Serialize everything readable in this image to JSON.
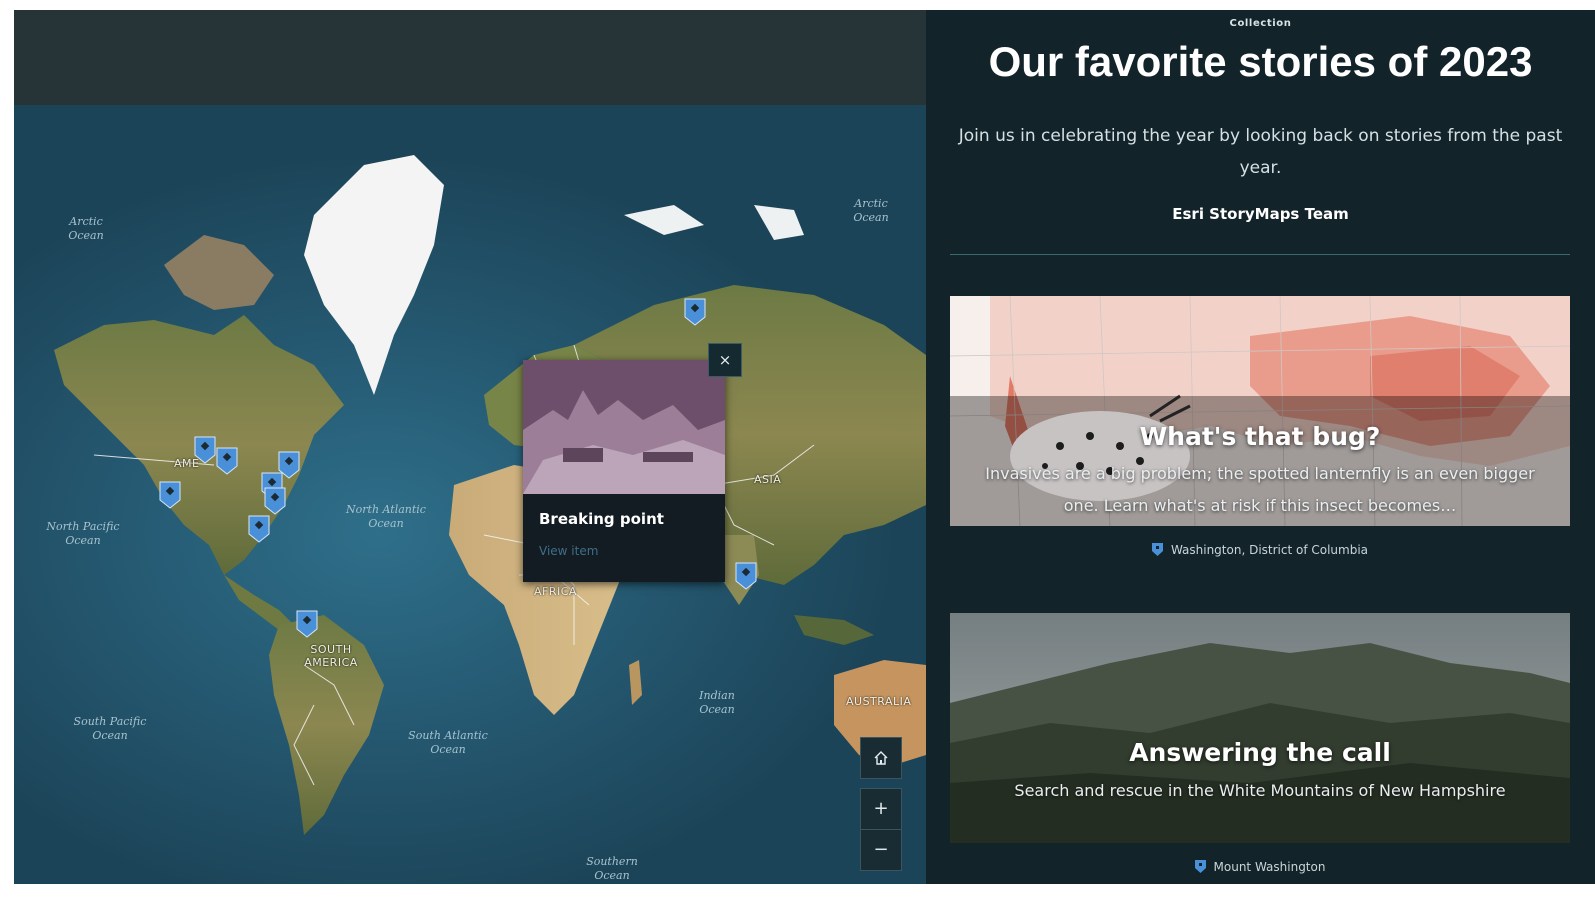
{
  "collection": {
    "eyebrow": "Collection",
    "title": "Our favorite stories of 2023",
    "subtitle": "Join us in celebrating the year by looking back on stories from the past year.",
    "author": "Esri StoryMaps Team"
  },
  "map": {
    "ocean_labels": [
      {
        "text": "Arctic Ocean"
      },
      {
        "text": "Arctic Ocean"
      },
      {
        "text": "North Pacific Ocean"
      },
      {
        "text": "North Atlantic Ocean"
      },
      {
        "text": "South Pacific Ocean"
      },
      {
        "text": "South Atlantic Ocean"
      },
      {
        "text": "Indian Ocean"
      },
      {
        "text": "Southern Ocean"
      }
    ],
    "land_labels": [
      {
        "text": "ASIA"
      },
      {
        "text": "AFRICA"
      },
      {
        "text": "SOUTH AMERICA"
      },
      {
        "text": "AUSTRALIA"
      },
      {
        "text": "AME"
      }
    ],
    "popup": {
      "title": "Breaking point",
      "link": "View item",
      "close_symbol": "×"
    },
    "controls": {
      "home_icon": "home-icon",
      "zoom_in": "+",
      "zoom_out": "−"
    },
    "pin_color": "#4a90d9"
  },
  "cards": [
    {
      "title": "What's that bug?",
      "description": "Invasives are a big problem; the spotted lanternfly is an even bigger one. Learn what's at risk if this insect becomes…",
      "location": "Washington, District of Columbia"
    },
    {
      "title": "Answering the call",
      "description": "Search and rescue in the White Mountains of New Hampshire",
      "location": "Mount Washington"
    }
  ],
  "colors": {
    "panel_bg": "#12232a",
    "header_bg": "#263438",
    "accent": "#4a90d9"
  }
}
